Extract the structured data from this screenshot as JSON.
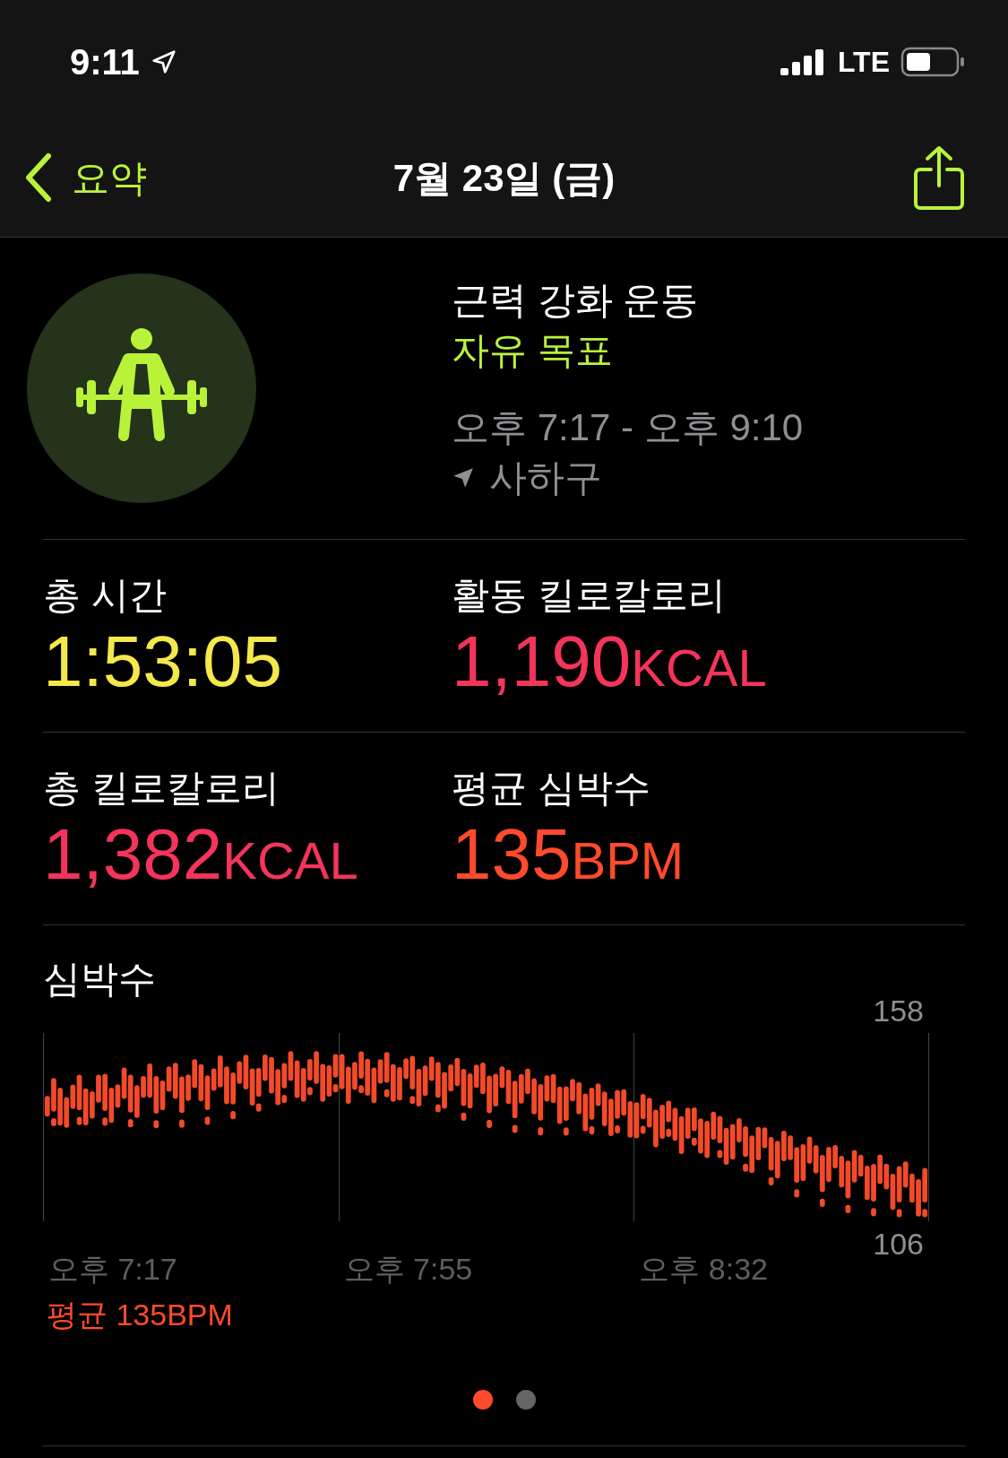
{
  "status_bar": {
    "time": "9:11",
    "network": "LTE"
  },
  "nav": {
    "back_label": "요약",
    "title": "7월 23일 (금)"
  },
  "workout": {
    "name": "근력 강화 운동",
    "goal": "자유 목표",
    "time_range": "오후 7:17 - 오후 9:10",
    "location": "사하구"
  },
  "stats": [
    {
      "label": "총 시간",
      "value": "1:53:05",
      "color": "#f4e84a"
    },
    {
      "label": "활동 킬로칼로리",
      "value": "1,190",
      "unit": "KCAL",
      "color": "#f4345b"
    },
    {
      "label": "총 킬로칼로리",
      "value": "1,382",
      "unit": "KCAL",
      "color": "#f4345b"
    },
    {
      "label": "평균 심박수",
      "value": "135",
      "unit": "BPM",
      "color": "#ff4a2c"
    }
  ],
  "heart_rate": {
    "title": "심박수",
    "y_max": "158",
    "y_min": "106",
    "x_labels": [
      "오후 7:17",
      "오후 7:55",
      "오후 8:32"
    ],
    "average": "평균 135BPM"
  },
  "pages": [
    {
      "selected": true
    },
    {
      "selected": false
    }
  ]
}
